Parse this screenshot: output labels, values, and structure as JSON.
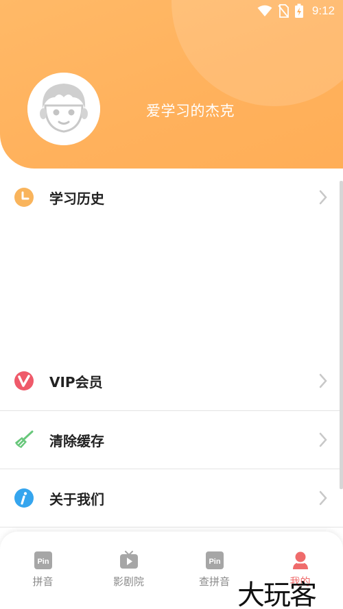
{
  "status_bar": {
    "time": "9:12",
    "icons": [
      "wifi-icon",
      "no-sim-icon",
      "battery-charging-icon"
    ]
  },
  "profile": {
    "username": "爱学习的杰克",
    "avatar_icon": "boy-avatar-icon"
  },
  "menu": [
    {
      "label": "学习历史",
      "icon": "clock-icon",
      "color": "#f9b45c"
    },
    {
      "label": "VIP会员",
      "icon": "vip-icon",
      "color": "#ef5a6a"
    },
    {
      "label": "清除缓存",
      "icon": "broom-icon",
      "color": "#68c77b"
    },
    {
      "label": "关于我们",
      "icon": "info-icon",
      "color": "#35a5ee"
    }
  ],
  "bottom_nav": [
    {
      "label": "拼音",
      "icon": "pin-icon",
      "active": false
    },
    {
      "label": "影剧院",
      "icon": "tv-play-icon",
      "active": false
    },
    {
      "label": "查拼音",
      "icon": "pin-icon",
      "active": false
    },
    {
      "label": "我的",
      "icon": "profile-icon",
      "active": true
    }
  ],
  "watermark": "大玩客",
  "colors": {
    "header": "#ffb15c",
    "active_tab": "#ef6b6b"
  }
}
